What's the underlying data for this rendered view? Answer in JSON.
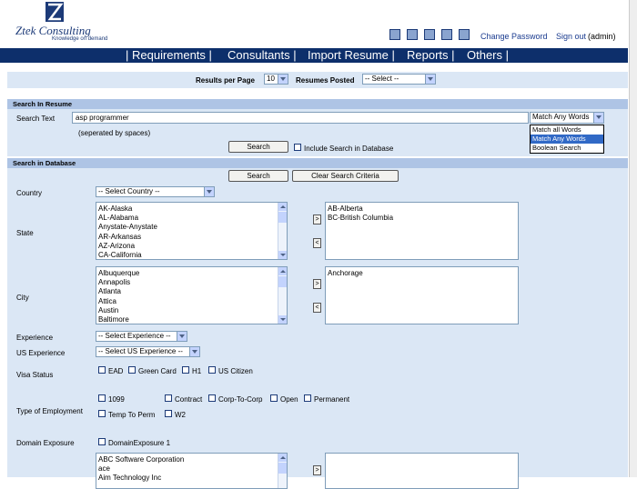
{
  "brand": {
    "title": "Ztek Consulting",
    "tagline": "Knowledge on demand"
  },
  "topbar": {
    "change_password": "Change Password",
    "sign_out": "Sign out",
    "user": "(admin)"
  },
  "nav": [
    "| Requirements |",
    "Consultants |",
    "Import Resume |",
    "Reports |",
    "Others |"
  ],
  "filters": {
    "results_per_page_label": "Results per Page",
    "results_per_page_value": "10",
    "resumes_posted_label": "Resumes Posted",
    "resumes_posted_value": "-- Select --"
  },
  "resume_search": {
    "header": "Search In Resume",
    "label": "Search Text",
    "value": "asp programmer",
    "hint": "(seperated by spaces)",
    "match_selected": "Match Any Words",
    "match_options": [
      "Match all Words",
      "Match Any Words",
      "Boolean Search"
    ],
    "search_button": "Search",
    "include_label": "Include Search in Database"
  },
  "db_search": {
    "header": "Search in Database",
    "search_button": "Search",
    "clear_button": "Clear Search Criteria",
    "country_label": "Country",
    "country_value": "-- Select Country --",
    "state_label": "State",
    "states": [
      "AK-Alaska",
      "AL-Alabama",
      "Anystate-Anystate",
      "AR-Arkansas",
      "AZ-Arizona",
      "CA-California"
    ],
    "selected_states": [
      "AB-Alberta",
      "BC-British Columbia"
    ],
    "city_label": "City",
    "cities": [
      "Albuquerque",
      "Annapolis",
      "Atlanta",
      "Attica",
      "Austin",
      "Baltimore"
    ],
    "selected_cities": [
      "Anchorage"
    ],
    "move_right": ">",
    "move_left": "<",
    "experience_label": "Experience",
    "experience_value": "-- Select Experience --",
    "us_experience_label": "US Experience",
    "us_experience_value": "-- Select US Experience --",
    "visa_label": "Visa Status",
    "visa_options": [
      "EAD",
      "Green Card",
      "H1",
      "US Citizen"
    ],
    "employment_label": "Type of Employment",
    "employment_options": [
      "1099",
      "Contract",
      "Corp-To-Corp",
      "Open",
      "Permanent",
      "Temp To Perm",
      "W2"
    ],
    "domain_label": "Domain Exposure",
    "domain_option": "DomainExposure 1",
    "companies": [
      "ABC Software Corporation",
      "ace",
      "Aim Technology Inc"
    ]
  }
}
